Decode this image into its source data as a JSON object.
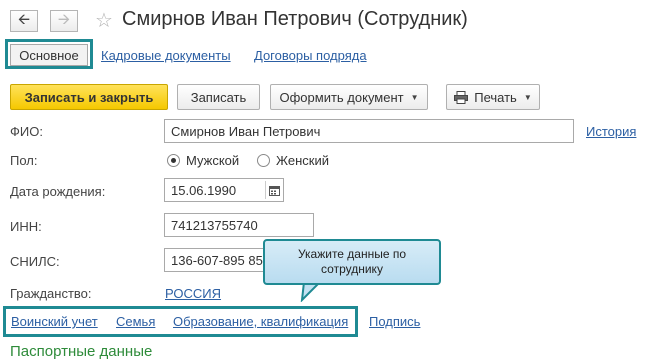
{
  "header": {
    "back_icon": "arrow-left",
    "forward_icon": "arrow-right",
    "favorite_icon": "star",
    "title": "Смирнов Иван Петрович (Сотрудник)"
  },
  "tabs": [
    {
      "label": "Основное",
      "active": true
    },
    {
      "label": "Кадровые документы"
    },
    {
      "label": "Договоры подряда"
    }
  ],
  "toolbar": {
    "save_close": "Записать и закрыть",
    "save": "Записать",
    "create_document": "Оформить документ",
    "print": "Печать",
    "print_icon": "printer"
  },
  "form": {
    "fio_label": "ФИО:",
    "fio_value": "Смирнов Иван Петрович",
    "history_link": "История",
    "gender_label": "Пол:",
    "gender_male": "Мужской",
    "gender_female": "Женский",
    "gender_selected": "Мужской",
    "birth_label": "Дата рождения:",
    "birth_value": "15.06.1990",
    "calendar_icon": "calendar",
    "inn_label": "ИНН:",
    "inn_value": "741213755740",
    "snils_label": "СНИЛС:",
    "snils_value": "136-607-895 85",
    "citizenship_label": "Гражданство:",
    "citizenship_value": "РОССИЯ"
  },
  "callout": {
    "text": "Укажите данные по сотруднику"
  },
  "subtabs": [
    {
      "label": "Воинский учет"
    },
    {
      "label": "Семья"
    },
    {
      "label": "Образование, квалификация"
    },
    {
      "label": "Подпись"
    }
  ],
  "section": {
    "title": "Паспортные данные"
  },
  "colors": {
    "accent_teal": "#1f8a93",
    "primary_yellow": "#f5c800",
    "link_blue": "#2c5fa3",
    "section_green": "#2e8b3a"
  }
}
